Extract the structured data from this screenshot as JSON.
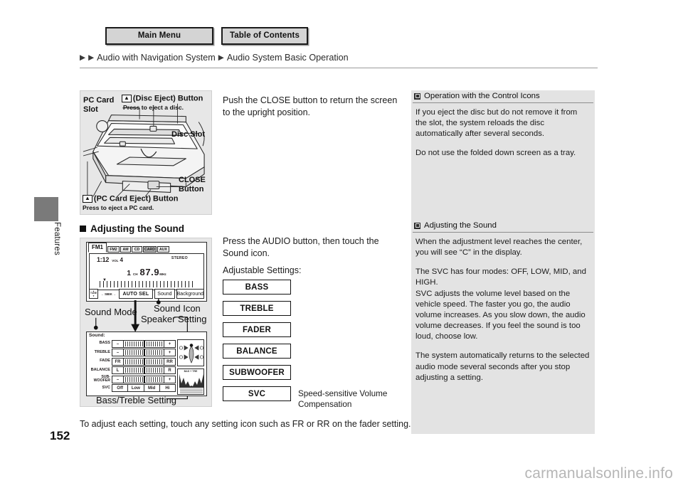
{
  "topnav": {
    "main_menu": "Main Menu",
    "table_of_contents": "Table of Contents"
  },
  "breadcrumb": {
    "arrow": "▶",
    "level1": "Audio with Navigation System",
    "level2": "Audio System Basic Operation"
  },
  "side_tab": {
    "label": "Features"
  },
  "page_number": "152",
  "figure_unit": {
    "pc_card_slot_line1": "PC Card",
    "pc_card_slot_line2": "Slot",
    "disc_eject_glyph": "▲",
    "disc_eject_label": "(Disc Eject) Button",
    "disc_eject_sub": "Press to eject a disc.",
    "disc_slot": "Disc Slot",
    "close_line1": "CLOSE",
    "close_line2": "Button",
    "pc_eject_glyph": "▲",
    "pc_eject_label": "(PC Card Eject) Button",
    "pc_eject_sub": "Press to eject a PC card."
  },
  "heading_adjusting": "Adjusting the Sound",
  "audio_screen": {
    "tabs": [
      "FM1",
      "FM2",
      "AM",
      "CD",
      "CARD",
      "AUX"
    ],
    "selected_tab": "FM1",
    "time": "1:12",
    "vol_label": "VOL",
    "vol_value": "4",
    "stereo": "STEREO",
    "channel_number": "1",
    "channel_label": "CH",
    "frequency": "87.9",
    "frequency_unit": "MHz",
    "tune_label": "TUNE",
    "seek_label": "SEEK",
    "auto_sel": "AUTO SEL",
    "sound": "Sound",
    "background": "Background"
  },
  "figure_callouts": {
    "sound_mode": "Sound Mode",
    "sound_icon": "Sound Icon",
    "speaker_setting": "Speaker Setting",
    "bass_treble_setting": "Bass/Treble Setting"
  },
  "sound_panel": {
    "title": "Sound:",
    "rows": [
      {
        "label": "BASS",
        "left": "–",
        "right": "+"
      },
      {
        "label": "TREBLE",
        "left": "–",
        "right": "+"
      },
      {
        "label": "FADE",
        "left": "FR",
        "right": "RR"
      },
      {
        "label": "BALANCE",
        "left": "L",
        "right": "R"
      },
      {
        "label": "SUB-WOOFER",
        "left": "–",
        "right": "+"
      }
    ],
    "svc_label": "SVC",
    "svc_options": [
      "Off",
      "Low",
      "Mid",
      "Hi"
    ],
    "bass_treble_scale": "BAS  +  TRE"
  },
  "main_text": {
    "close_instruction": "Push the CLOSE button to return the screen to the upright position.",
    "press_audio": "Press the AUDIO button, then touch the Sound icon.",
    "adjustable_settings": "Adjustable Settings:",
    "bottom_note": "To adjust each setting, touch any setting icon such as FR or RR on the fader setting."
  },
  "setting_buttons": [
    "BASS",
    "TREBLE",
    "FADER",
    "BALANCE",
    "SUBWOOFER",
    "SVC"
  ],
  "svc_annotation": "Speed-sensitive Volume Compensation",
  "sidebar": [
    {
      "title": "Operation with the Control Icons",
      "paragraphs": [
        "If you eject the disc but do not remove it from the slot, the system reloads the disc automatically after several seconds.",
        "Do not use the folded down screen as a tray."
      ]
    },
    {
      "title": "Adjusting the Sound",
      "paragraphs": [
        "When the adjustment level reaches the center, you will see “C” in the display.",
        "The SVC has four modes: OFF, LOW, MID, and HIGH.\nSVC adjusts the volume level based on the vehicle speed. The faster you go, the audio volume increases. As you slow down, the audio volume decreases. If you feel the sound is too loud, choose low.",
        "The system automatically returns to the selected audio mode several seconds after you stop adjusting a setting."
      ]
    }
  ],
  "watermark": "carmanualsonline.info"
}
